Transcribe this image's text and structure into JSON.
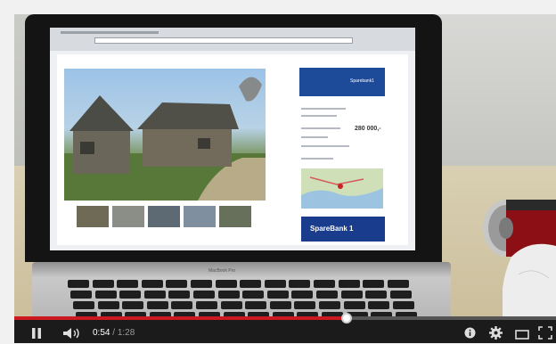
{
  "video": {
    "laptop_brand": "MacBook Pro",
    "browser": {
      "bank_header": "Sparebank1",
      "price": "280 000,-",
      "bank_logo": "SpareBank 1"
    }
  },
  "controls": {
    "current_time": "0:54",
    "separator": " / ",
    "duration": "1:28",
    "progress_fraction": 0.6136,
    "icons": {
      "play": "pause-icon",
      "volume": "volume-icon",
      "info": "info-icon",
      "settings": "gear-icon",
      "theater": "theater-mode-icon",
      "fullscreen": "fullscreen-icon"
    }
  },
  "colors": {
    "progress": "#cc181e",
    "controls_bg": "#1b1b1b",
    "bank_blue": "#1e4a9a"
  }
}
